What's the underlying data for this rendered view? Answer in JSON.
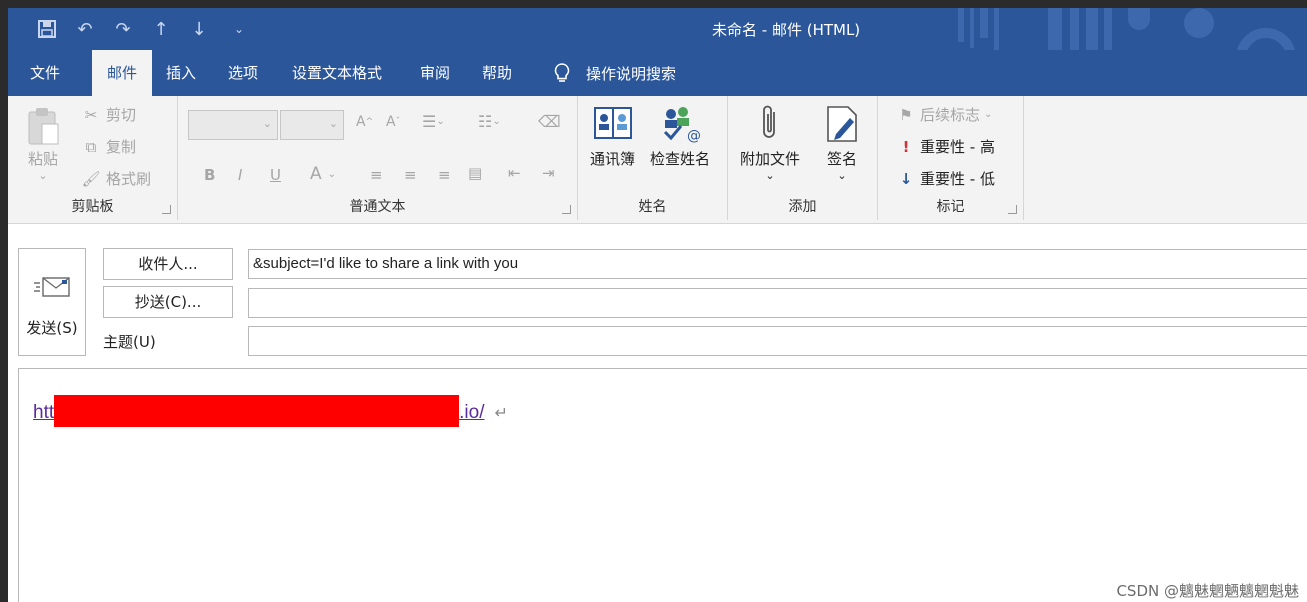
{
  "window": {
    "title": "未命名 - 邮件 (HTML)"
  },
  "tabs": [
    {
      "label": "文件",
      "active": false
    },
    {
      "label": "邮件",
      "active": true
    },
    {
      "label": "插入",
      "active": false
    },
    {
      "label": "选项",
      "active": false
    },
    {
      "label": "设置文本格式",
      "active": false
    },
    {
      "label": "审阅",
      "active": false
    },
    {
      "label": "帮助",
      "active": false
    }
  ],
  "tell_me": "操作说明搜索",
  "ribbon": {
    "clipboard": {
      "paste": "粘贴",
      "cut": "剪切",
      "copy": "复制",
      "format_painter": "格式刷",
      "label": "剪贴板"
    },
    "basic_text": {
      "bold": "B",
      "italic": "I",
      "underline": "U",
      "font_color": "A",
      "label": "普通文本"
    },
    "names": {
      "address_book": "通讯簿",
      "check_names": "检查姓名",
      "label": "姓名"
    },
    "include": {
      "attach_file": "附加文件",
      "signature": "签名",
      "label": "添加"
    },
    "tags": {
      "follow_up": "后续标志",
      "high_importance": "重要性 - 高",
      "low_importance": "重要性 - 低",
      "label": "标记"
    }
  },
  "compose": {
    "send": "发送(S)",
    "to_button": "收件人...",
    "cc_button": "抄送(C)...",
    "subject_label": "主题(U)",
    "to_value": "&subject=I'd like to share a link with you",
    "cc_value": "",
    "subject_value": ""
  },
  "body": {
    "link_prefix": "htt",
    "link_suffix": ".io/",
    "paragraph_mark": "↵"
  },
  "watermark": "CSDN @魑魅魍魉魑魍魁魅",
  "colors": {
    "accent": "#2b579a",
    "redaction": "#ff0000",
    "link": "#5b2c9e"
  }
}
